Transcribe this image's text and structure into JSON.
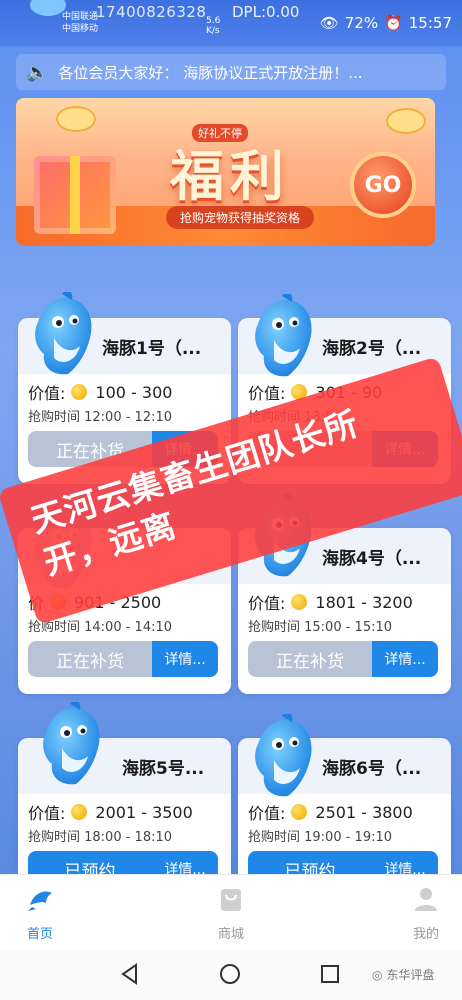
{
  "status_bar": {
    "carrier1": "中国联通",
    "carrier2": "中国移动",
    "phone": "17400826328",
    "dpl": "DPL:0.00",
    "speed_value": "5.6",
    "speed_unit": "K/s",
    "battery": "72%",
    "time": "15:57"
  },
  "notice": {
    "text": "各位会员大家好：  海豚协议正式开放注册！..."
  },
  "banner": {
    "tag": "好礼不停",
    "main": "福利",
    "sub": "抢购宠物获得抽奖资格",
    "go": "GO"
  },
  "cards": [
    {
      "title": "海豚1号（...",
      "price_label": "价值:",
      "price": "100 - 300",
      "time": "抢购时间 12:00 - 12:10",
      "action": "正在补货",
      "detail": "详情..."
    },
    {
      "title": "海豚2号（...",
      "price_label": "价值:",
      "price": "301 - 90",
      "time": "抢购时间 13:0",
      "action": "",
      "detail": "详情..."
    },
    {
      "title": "",
      "price_label": "价",
      "price": "901 - 2500",
      "time": "抢购时间 14:00 - 14:10",
      "action": "正在补货",
      "detail": "详情..."
    },
    {
      "title": "海豚4号（...",
      "price_label": "价值:",
      "price": "1801 - 3200",
      "time": "抢购时间 15:00 - 15:10",
      "action": "正在补货",
      "detail": "详情..."
    },
    {
      "title": "海豚5号...",
      "price_label": "价值:",
      "price": "2001 - 3500",
      "time": "抢购时间 18:00 - 18:10",
      "action": "已预约",
      "detail": "详情..."
    },
    {
      "title": "海豚6号（...",
      "price_label": "价值:",
      "price": "2501 - 3800",
      "time": "抢购时间 19:00 - 19:10",
      "action": "已预约",
      "detail": "详情..."
    }
  ],
  "stamp": {
    "line1": "天河云集畜生团队长所",
    "line2": "开，远离"
  },
  "tabbar": {
    "home": "首页",
    "mall": "商城",
    "mine": "我的"
  },
  "watermark": "东华评盘",
  "colors": {
    "accent": "#1f87e8",
    "stamp": "#ff3c3c",
    "disabled_button": "#b8c4d6"
  }
}
